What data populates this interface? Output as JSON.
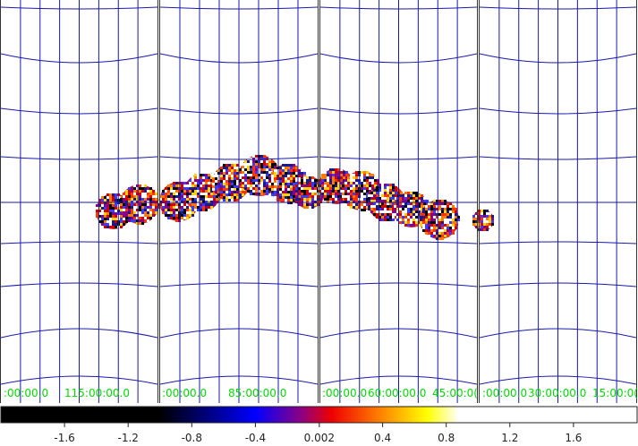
{
  "viewer": {
    "background": "#ffffff",
    "grid_color": "#1a1aaa",
    "label_color": "#00dd00",
    "separator_color": "#333333",
    "panels": [
      {
        "coord_labels": [
          ":00:00.0",
          "115:00:00.0"
        ]
      },
      {
        "coord_labels": [
          ":00:00.0",
          "85:00:00.0"
        ]
      },
      {
        "coord_labels": [
          ":00:00.0",
          "60:00:00.0",
          "45:00:0("
        ]
      },
      {
        "coord_labels": [
          ":00:00.0",
          "30:00:00.0",
          "15:00:0("
        ]
      }
    ]
  },
  "colorbar": {
    "colormap": "bb",
    "ticks": [
      "-1.6",
      "-1.2",
      "-0.8",
      "-0.4",
      "0.002",
      "0.4",
      "0.8",
      "1.2",
      "1.6"
    ],
    "tick_values": [
      -1.6,
      -1.2,
      -0.8,
      -0.4,
      0.002,
      0.4,
      0.8,
      1.2,
      1.6
    ],
    "range": [
      -2.0,
      2.0
    ]
  }
}
